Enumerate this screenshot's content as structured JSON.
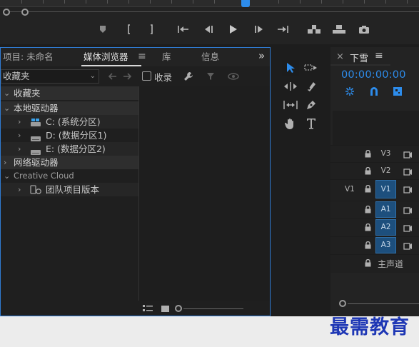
{
  "transport": {
    "buttons": [
      "marker-icon",
      "mark-in-icon",
      "mark-out-icon",
      "go-to-in-icon",
      "step-back-icon",
      "play-icon",
      "step-forward-icon",
      "go-to-out-icon",
      "insert-icon",
      "overwrite-icon",
      "export-frame-icon"
    ]
  },
  "project_panel": {
    "tabs": [
      {
        "label": "项目: 未命名"
      },
      {
        "label": "媒体浏览器"
      },
      {
        "label": "≡"
      },
      {
        "label": "库"
      },
      {
        "label": "信息"
      }
    ],
    "overflow": "»",
    "dropdown_value": "收藏夹",
    "ingest_label": "收录",
    "tree": {
      "favorites": "收藏夹",
      "local_drives": "本地驱动器",
      "drive_c": "C: (系统分区)",
      "drive_d": "D: (数据分区1)",
      "drive_e": "E: (数据分区2)",
      "network_drives": "网络驱动器",
      "creative_cloud": "Creative Cloud",
      "team_project": "团队项目版本"
    }
  },
  "sequence": {
    "close": "×",
    "name": "下雪",
    "menu": "≡",
    "timecode": "00:00:00:00",
    "tracks": [
      {
        "name": "V3",
        "source": "",
        "active": false
      },
      {
        "name": "V2",
        "source": "",
        "active": false
      },
      {
        "name": "V1",
        "source": "V1",
        "active": true
      },
      {
        "name": "A1",
        "source": "",
        "active": true
      },
      {
        "name": "A2",
        "source": "",
        "active": true
      },
      {
        "name": "A3",
        "source": "",
        "active": true
      }
    ],
    "master": "主声道"
  },
  "watermark": "最需教育",
  "colors": {
    "accent": "#2d8ceb",
    "track_active": "#1d4f7d",
    "watermark": "#1e37b5"
  }
}
